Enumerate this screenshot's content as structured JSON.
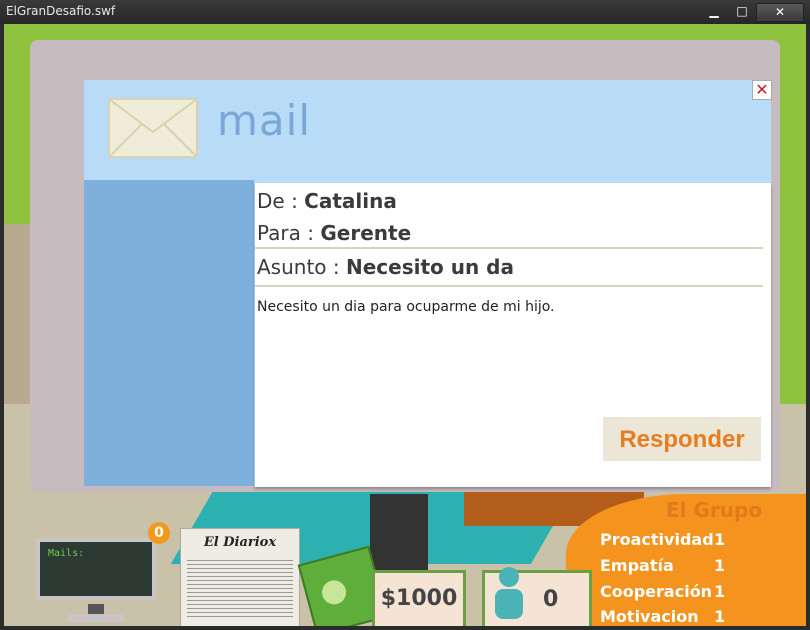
{
  "window": {
    "title": "ElGranDesafio.swf",
    "min_icon": "minimize-icon",
    "max_icon": "maximize-icon",
    "close_icon": "close-icon"
  },
  "mail": {
    "header_title": "mail",
    "close_glyph": "✕",
    "from_label": "De :",
    "from_value": "Catalina",
    "to_label": "Para :",
    "to_value": "Gerente",
    "subject_label": "Asunto :",
    "subject_value": "Necesito un da",
    "body": "Necesito un dia para ocuparme de mi hijo.",
    "reply_label": "Responder"
  },
  "hud": {
    "mails_label": "Mails:",
    "mail_count": "0",
    "newspaper_title": "El Diariox",
    "money": "$1000",
    "people_count": "0",
    "group_title": "El Grupo",
    "stats": [
      {
        "name": "Proactividad",
        "value": "1"
      },
      {
        "name": "Empatía",
        "value": "1"
      },
      {
        "name": "Cooperación",
        "value": "1"
      },
      {
        "name": "Motivacion",
        "value": "1"
      }
    ]
  },
  "colors": {
    "accent_orange": "#e87d20",
    "panel_blue": "#b8dcf8",
    "sidebar_blue": "#7fb0dc",
    "grass_green": "#8fc23f"
  }
}
